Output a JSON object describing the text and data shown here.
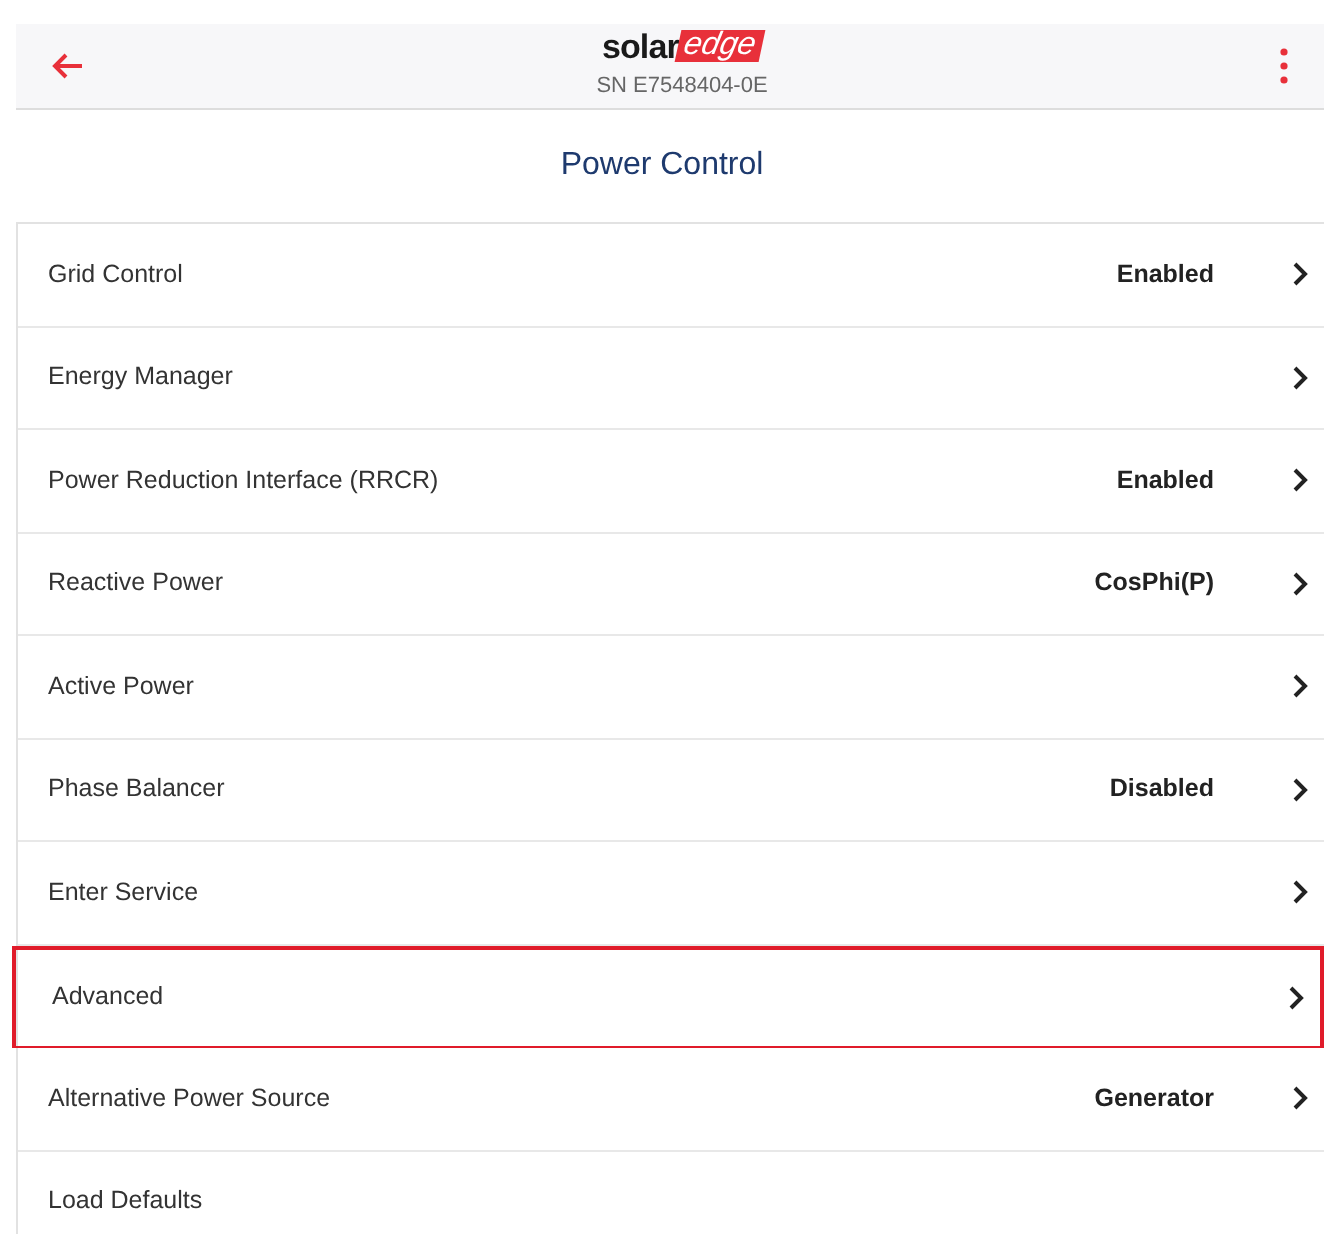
{
  "header": {
    "logo": {
      "part_1": "solar",
      "part_2": "edge"
    },
    "serial": "SN E7548404-0E"
  },
  "title": "Power Control",
  "items": [
    {
      "label": "Grid Control",
      "value": "Enabled",
      "kind": "nav",
      "highlighted": false
    },
    {
      "label": "Energy Manager",
      "kind": "nav",
      "highlighted": false
    },
    {
      "label": "Power Reduction Interface (RRCR)",
      "value": "Enabled",
      "kind": "nav",
      "highlighted": false
    },
    {
      "label": "Reactive Power",
      "value": "CosPhi(P)",
      "kind": "nav",
      "highlighted": false
    },
    {
      "label": "Active Power",
      "kind": "nav",
      "highlighted": false
    },
    {
      "label": "Phase Balancer",
      "value": "Disabled",
      "kind": "nav",
      "highlighted": false
    },
    {
      "label": "Enter Service",
      "kind": "nav",
      "highlighted": false
    },
    {
      "label": "Advanced",
      "kind": "nav",
      "highlighted": true
    },
    {
      "label": "Alternative Power Source",
      "value": "Generator",
      "kind": "nav",
      "highlighted": false
    },
    {
      "label": "Load Defaults",
      "kind": "action",
      "highlighted": false
    }
  ]
}
